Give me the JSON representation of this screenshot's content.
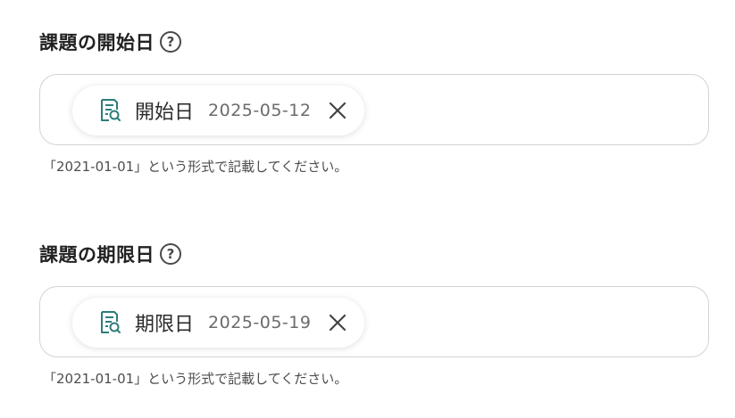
{
  "fields": [
    {
      "label": "課題の開始日",
      "help_icon": "question-circle-icon",
      "help_glyph": "?",
      "chip": {
        "icon": "document-search-icon",
        "name": "開始日",
        "value": "2025-05-12",
        "remove_icon": "close-icon"
      },
      "hint": "「2021-01-01」という形式で記載してください。"
    },
    {
      "label": "課題の期限日",
      "help_icon": "question-circle-icon",
      "help_glyph": "?",
      "chip": {
        "icon": "document-search-icon",
        "name": "期限日",
        "value": "2025-05-19",
        "remove_icon": "close-icon"
      },
      "hint": "「2021-01-01」という形式で記載してください。"
    }
  ],
  "colors": {
    "icon_accent": "#2d7d7a",
    "border": "#cfd3d8",
    "hint_text": "#4d4d4d"
  }
}
